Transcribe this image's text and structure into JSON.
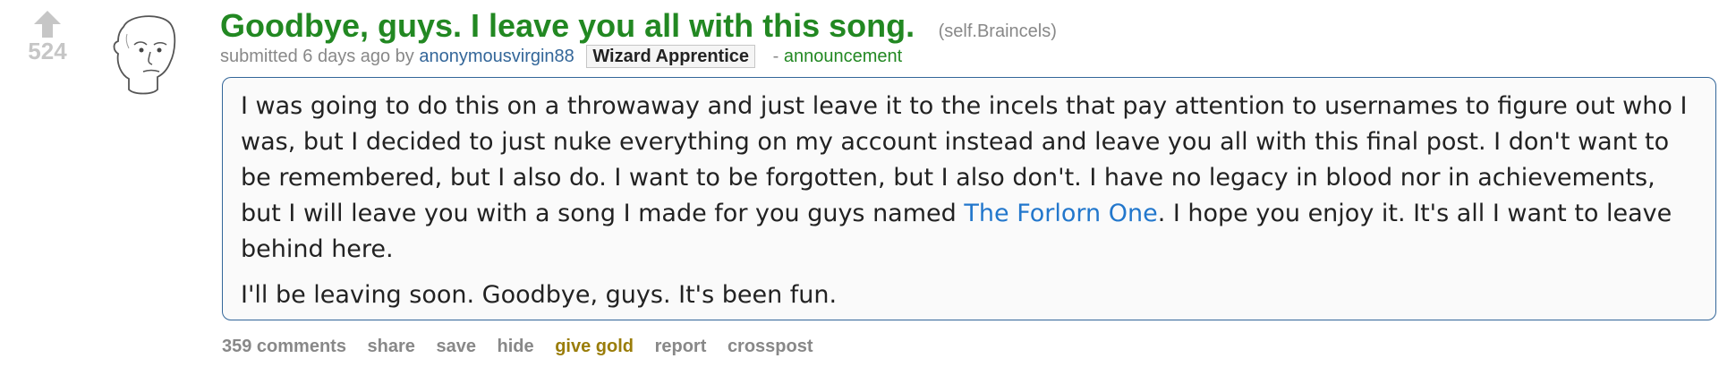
{
  "post": {
    "score": "524",
    "title": "Goodbye, guys. I leave you all with this song.",
    "domain": "(self.Braincels)",
    "tagline": {
      "prefix": "submitted 6 days ago by",
      "author": "anonymousvirgin88",
      "flair": "Wizard Apprentice",
      "separator": "-",
      "link_flair": "announcement"
    },
    "selftext": {
      "p1_before_link": "I was going to do this on a throwaway and just leave it to the incels that pay attention to usernames to figure out who I was, but I decided to just nuke everything on my account instead and leave you all with this final post. I don't want to be remembered, but I also do. I want to be forgotten, but I also don't. I have no legacy in blood nor in achievements, but I will leave you with a song I made for you guys named",
      "link_text": "The Forlorn One",
      "p1_after_link": ". I hope you enjoy it. It's all I want to leave behind here.",
      "p2": "I'll be leaving soon. Goodbye, guys. It's been fun."
    },
    "buttons": {
      "comments": "359 comments",
      "share": "share",
      "save": "save",
      "hide": "hide",
      "give_gold": "give gold",
      "report": "report",
      "crosspost": "crosspost"
    },
    "colors": {
      "title": "#228822",
      "author": "#336699",
      "link": "#2277cc",
      "gold": "#9a7d0a",
      "border": "#336699"
    },
    "icons": {
      "vote": "upvote-arrow-icon",
      "thumbnail": "wojak-face-thumbnail"
    }
  }
}
